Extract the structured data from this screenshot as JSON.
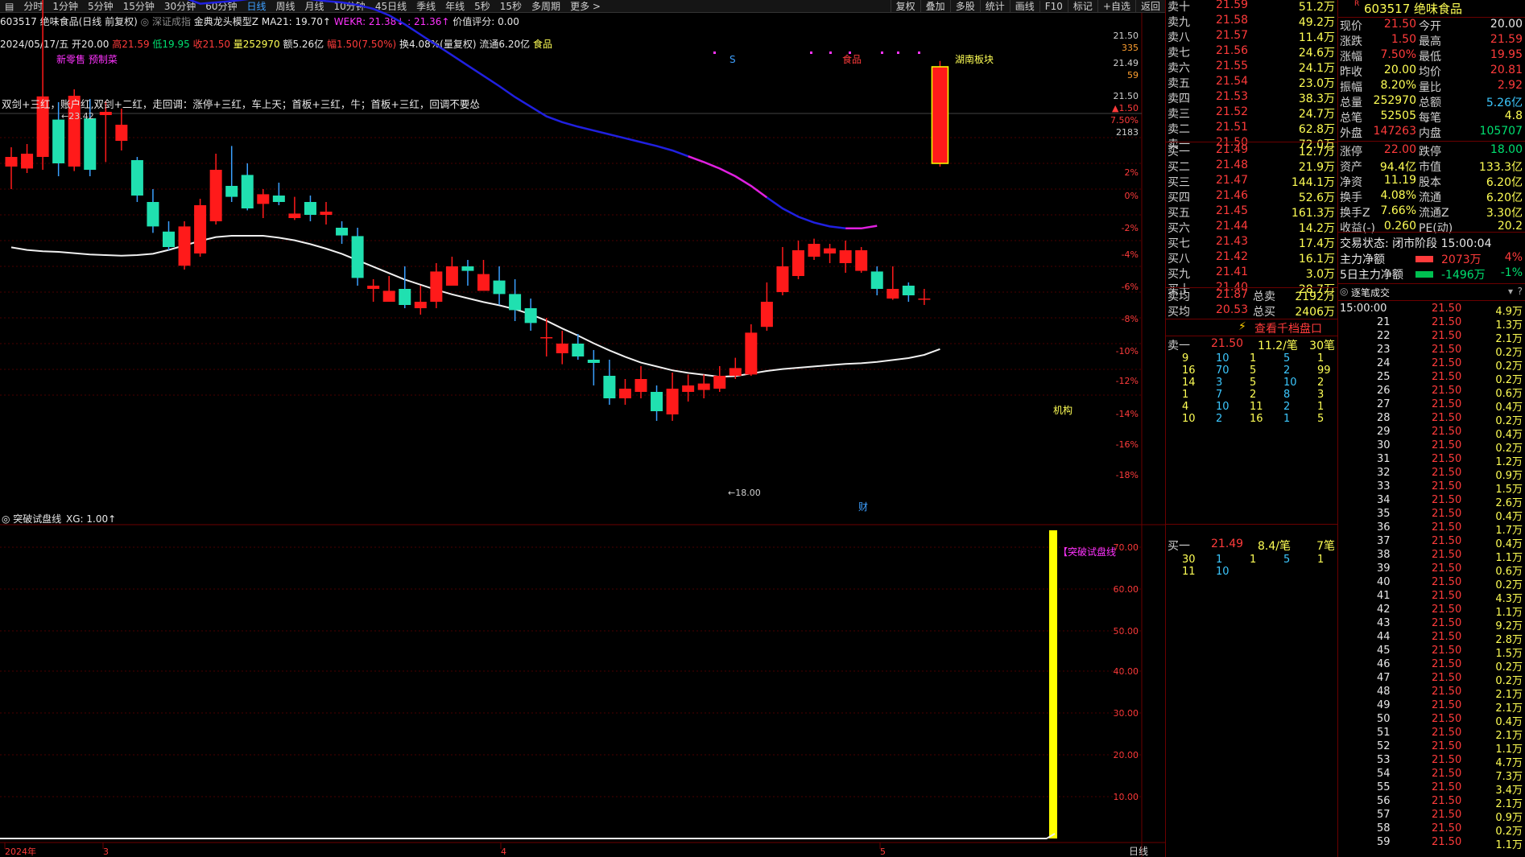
{
  "toolbar": {
    "tabs": [
      "分时",
      "1分钟",
      "5分钟",
      "15分钟",
      "30分钟",
      "60分钟",
      "日线",
      "周线",
      "月线",
      "10分钟",
      "45日线",
      "季线",
      "年线",
      "5秒",
      "15秒",
      "多周期",
      "更多 >"
    ],
    "active_index": 6,
    "right_items": [
      "复权",
      "叠加",
      "多股",
      "统计",
      "画线",
      "F10",
      "标记",
      "+自选",
      "返回"
    ]
  },
  "header": {
    "title": "603517 绝味食品(日线 前复权)",
    "indicator_label": "深证成指",
    "model_label": "金典龙头模型Z",
    "ma_text": "MA21: 19.70↑",
    "wekr_text": "WEKR: 21.38↓",
    "wekr2_text": ": 21.36↑",
    "score_text": "价值评分: 0.00"
  },
  "ohlc": {
    "date": "2024/05/17/五",
    "open": "开20.00",
    "high": "高21.59",
    "low": "低19.95",
    "close": "收21.50",
    "volume": "量252970",
    "amount": "额5.26亿",
    "range": "幅1.50(7.50%)",
    "turnover": "换4.08%(量复权)",
    "float": "流通6.20亿",
    "sector": "食品"
  },
  "annotations": {
    "top_left": "新零售 预制菜",
    "note": "双剑+三红，账户红,双剑+二红，走回调：涨停+三红，车上天；首板+三红，牛；首板+三红，回调不要怂",
    "s_label": "S",
    "food_label": "食品",
    "hunan_label": "湖南板块",
    "jigou_label": "机构",
    "cai_label": "财",
    "high_mark": "←23.42",
    "low_mark": "←18.00"
  },
  "price_axis": {
    "labels": [
      "21.50",
      "335",
      "21.49",
      "59",
      "21.50",
      "▲1.50",
      "7.50%",
      "2183",
      "2%",
      "0%",
      "-2%",
      "-4%",
      "-6%",
      "-8%",
      "-10%",
      "-12%",
      "-14%",
      "-16%",
      "-18%"
    ]
  },
  "indicator": {
    "title": "突破试盘线",
    "xg": "XG: 1.00↑",
    "signal_label": "【突破试盘线",
    "axis": [
      "70.00",
      "60.00",
      "50.00",
      "40.00",
      "30.00",
      "20.00",
      "10.00"
    ]
  },
  "date_axis": [
    "2024年",
    "3",
    "4",
    "5"
  ],
  "period_label": "日线",
  "chart_data": {
    "type": "candlestick",
    "candles": [
      {
        "o": 19.95,
        "c": 20.1,
        "h": 20.25,
        "l": 19.6
      },
      {
        "o": 19.92,
        "c": 20.15,
        "h": 20.3,
        "l": 19.85
      },
      {
        "o": 20.1,
        "c": 21.04,
        "h": 23.42,
        "l": 19.9
      },
      {
        "o": 20.68,
        "c": 20.0,
        "h": 20.95,
        "l": 19.8
      },
      {
        "o": 19.95,
        "c": 21.05,
        "h": 21.15,
        "l": 19.88
      },
      {
        "o": 20.7,
        "c": 19.9,
        "h": 21.0,
        "l": 19.8
      },
      {
        "o": 20.75,
        "c": 20.8,
        "h": 20.97,
        "l": 20.02
      },
      {
        "o": 20.35,
        "c": 20.6,
        "h": 20.85,
        "l": 20.2
      },
      {
        "o": 20.05,
        "c": 19.5,
        "h": 20.1,
        "l": 19.4
      },
      {
        "o": 19.4,
        "c": 19.02,
        "h": 19.6,
        "l": 18.92
      },
      {
        "o": 18.94,
        "c": 18.7,
        "h": 19.1,
        "l": 18.65
      },
      {
        "o": 18.41,
        "c": 19.02,
        "h": 19.1,
        "l": 18.35
      },
      {
        "o": 18.6,
        "c": 19.35,
        "h": 19.45,
        "l": 18.55
      },
      {
        "o": 19.1,
        "c": 19.9,
        "h": 20.15,
        "l": 19.05
      },
      {
        "o": 19.65,
        "c": 19.48,
        "h": 20.27,
        "l": 19.4
      },
      {
        "o": 19.82,
        "c": 19.3,
        "h": 20.0,
        "l": 19.27
      },
      {
        "o": 19.37,
        "c": 19.52,
        "h": 19.6,
        "l": 19.15
      },
      {
        "o": 19.5,
        "c": 19.4,
        "h": 19.7,
        "l": 19.35
      },
      {
        "o": 19.15,
        "c": 19.22,
        "h": 19.48,
        "l": 19.12
      },
      {
        "o": 19.4,
        "c": 19.2,
        "h": 19.5,
        "l": 19.1
      },
      {
        "o": 19.2,
        "c": 19.25,
        "h": 19.4,
        "l": 19.05
      },
      {
        "o": 19.0,
        "c": 18.88,
        "h": 19.1,
        "l": 18.75
      },
      {
        "o": 18.87,
        "c": 18.22,
        "h": 19.0,
        "l": 18.1
      },
      {
        "o": 18.05,
        "c": 18.1,
        "h": 18.2,
        "l": 17.85
      },
      {
        "o": 17.85,
        "c": 18.02,
        "h": 18.25,
        "l": 17.88
      },
      {
        "o": 18.05,
        "c": 17.8,
        "h": 18.4,
        "l": 17.75
      },
      {
        "o": 17.75,
        "c": 17.85,
        "h": 18.1,
        "l": 17.65
      },
      {
        "o": 17.85,
        "c": 18.32,
        "h": 18.45,
        "l": 17.75
      },
      {
        "o": 18.1,
        "c": 18.4,
        "h": 18.55,
        "l": 18.1
      },
      {
        "o": 18.4,
        "c": 18.33,
        "h": 18.5,
        "l": 18.1
      },
      {
        "o": 18.02,
        "c": 18.28,
        "h": 18.5,
        "l": 18.22
      },
      {
        "o": 18.18,
        "c": 17.97,
        "h": 18.4,
        "l": 17.8
      },
      {
        "o": 17.97,
        "c": 17.72,
        "h": 18.2,
        "l": 17.55
      },
      {
        "o": 17.75,
        "c": 17.52,
        "h": 17.9,
        "l": 17.4
      },
      {
        "o": 17.3,
        "c": 17.3,
        "h": 17.6,
        "l": 17.0
      },
      {
        "o": 17.05,
        "c": 17.2,
        "h": 17.4,
        "l": 16.88
      },
      {
        "o": 17.2,
        "c": 17.0,
        "h": 17.35,
        "l": 16.95
      },
      {
        "o": 16.95,
        "c": 16.9,
        "h": 17.1,
        "l": 16.55
      },
      {
        "o": 16.7,
        "c": 16.35,
        "h": 16.95,
        "l": 16.25
      },
      {
        "o": 16.35,
        "c": 16.5,
        "h": 16.65,
        "l": 16.25
      },
      {
        "o": 16.45,
        "c": 16.65,
        "h": 16.85,
        "l": 16.35
      },
      {
        "o": 16.45,
        "c": 16.15,
        "h": 16.55,
        "l": 16.0
      },
      {
        "o": 16.1,
        "c": 16.5,
        "h": 16.75,
        "l": 16.0
      },
      {
        "o": 16.45,
        "c": 16.55,
        "h": 16.72,
        "l": 16.3
      },
      {
        "o": 16.48,
        "c": 16.58,
        "h": 16.72,
        "l": 16.35
      },
      {
        "o": 16.5,
        "c": 16.7,
        "h": 16.85,
        "l": 16.45
      },
      {
        "o": 16.7,
        "c": 16.82,
        "h": 16.98,
        "l": 16.65
      },
      {
        "o": 16.72,
        "c": 17.37,
        "h": 17.5,
        "l": 16.7
      },
      {
        "o": 17.46,
        "c": 17.85,
        "h": 18.15,
        "l": 17.4
      },
      {
        "o": 18.0,
        "c": 18.4,
        "h": 18.7,
        "l": 17.95
      },
      {
        "o": 18.25,
        "c": 18.65,
        "h": 18.8,
        "l": 18.2
      },
      {
        "o": 18.55,
        "c": 18.75,
        "h": 18.83,
        "l": 18.5
      },
      {
        "o": 18.6,
        "c": 18.68,
        "h": 18.75,
        "l": 18.45
      },
      {
        "o": 18.45,
        "c": 18.65,
        "h": 18.8,
        "l": 18.3
      },
      {
        "o": 18.33,
        "c": 18.65,
        "h": 18.7,
        "l": 18.3
      },
      {
        "o": 18.32,
        "c": 18.05,
        "h": 18.4,
        "l": 17.95
      },
      {
        "o": 17.9,
        "c": 18.05,
        "h": 18.4,
        "l": 17.88
      },
      {
        "o": 18.1,
        "c": 17.95,
        "h": 18.15,
        "l": 17.85
      },
      {
        "o": 17.9,
        "c": 17.9,
        "h": 18.05,
        "l": 17.8
      },
      {
        "o": 20.0,
        "c": 21.5,
        "h": 21.59,
        "l": 19.95
      }
    ],
    "ma_white": [
      19.42,
      19.38,
      19.36,
      19.35,
      19.33,
      19.31,
      19.3,
      19.29,
      19.3,
      19.32,
      19.38,
      19.45,
      19.52,
      19.58,
      19.6,
      19.6,
      19.6,
      19.57,
      19.53,
      19.47,
      19.4,
      19.32,
      19.22,
      19.12,
      19.02,
      18.92,
      18.84,
      18.76,
      18.69,
      18.63,
      18.57,
      18.52,
      18.46,
      18.38,
      18.28,
      18.16,
      18.05,
      17.93,
      17.82,
      17.72,
      17.63,
      17.57,
      17.51,
      17.47,
      17.44,
      17.41,
      17.42,
      17.46,
      17.5,
      17.53,
      17.55,
      17.57,
      17.59,
      17.61,
      17.62,
      17.64,
      17.67,
      17.7,
      17.75,
      17.84
    ],
    "ma_blue": [
      23.07,
      23.07,
      22.98,
      22.87,
      22.75,
      22.65,
      22.5,
      22.32,
      22.12,
      21.92,
      21.74,
      21.57,
      21.48,
      21.5,
      21.52,
      21.55,
      21.58,
      21.6,
      21.58,
      21.55,
      21.52,
      21.5,
      21.46,
      21.4,
      21.3,
      21.16,
      21.0,
      20.84,
      20.68,
      20.52,
      20.36,
      20.2,
      20.03,
      19.88,
      19.73,
      19.64,
      19.57,
      19.51,
      19.45,
      19.39,
      19.33,
      19.27,
      19.2,
      19.11,
      19.02,
      18.92,
      18.8,
      18.65,
      18.47,
      18.3,
      18.17,
      18.08,
      18.02,
      17.99,
      17.99,
      18.03,
      18.12,
      18.28,
      18.49,
      18.71,
      18.92,
      19.13,
      19.34,
      19.55,
      19.71,
      19.84,
      19.92,
      19.9,
      19.75,
      19.4
    ],
    "signal_value": 75.0
  },
  "orderbook": {
    "asks": [
      {
        "label": "卖十",
        "price": "21.59",
        "vol": "51.2万"
      },
      {
        "label": "卖九",
        "price": "21.58",
        "vol": "49.2万"
      },
      {
        "label": "卖八",
        "price": "21.57",
        "vol": "11.4万"
      },
      {
        "label": "卖七",
        "price": "21.56",
        "vol": "24.6万"
      },
      {
        "label": "卖六",
        "price": "21.55",
        "vol": "24.1万"
      },
      {
        "label": "卖五",
        "price": "21.54",
        "vol": "23.0万"
      },
      {
        "label": "卖四",
        "price": "21.53",
        "vol": "38.3万"
      },
      {
        "label": "卖三",
        "price": "21.52",
        "vol": "24.7万"
      },
      {
        "label": "卖二",
        "price": "21.51",
        "vol": "62.8万"
      },
      {
        "label": "卖一",
        "price": "21.50",
        "vol": "72.0万"
      }
    ],
    "bids": [
      {
        "label": "买一",
        "price": "21.49",
        "vol": "12.7万"
      },
      {
        "label": "买二",
        "price": "21.48",
        "vol": "21.9万"
      },
      {
        "label": "买三",
        "price": "21.47",
        "vol": "144.1万"
      },
      {
        "label": "买四",
        "price": "21.46",
        "vol": "52.6万"
      },
      {
        "label": "买五",
        "price": "21.45",
        "vol": "161.3万"
      },
      {
        "label": "买六",
        "price": "21.44",
        "vol": "14.2万"
      },
      {
        "label": "买七",
        "price": "21.43",
        "vol": "17.4万"
      },
      {
        "label": "买八",
        "price": "21.42",
        "vol": "16.1万"
      },
      {
        "label": "买九",
        "price": "21.41",
        "vol": "3.0万"
      },
      {
        "label": "买十",
        "price": "21.40",
        "vol": "28.7万"
      }
    ],
    "avg_sell": {
      "label": "卖均",
      "price": "21.87",
      "tlabel": "总卖",
      "vol": "2192万"
    },
    "avg_buy": {
      "label": "买均",
      "price": "20.53",
      "tlabel": "总买",
      "vol": "2406万"
    },
    "link_text": "查看千档盘口",
    "sell1_line": {
      "label": "卖一",
      "price": "21.50",
      "avg": "11.2/笔",
      "count": "30笔"
    },
    "sell1_queue": [
      [
        "9",
        "10",
        "1",
        "5",
        "1"
      ],
      [
        "16",
        "70",
        "5",
        "2",
        "99"
      ],
      [
        "14",
        "3",
        "5",
        "10",
        "2"
      ],
      [
        "1",
        "7",
        "2",
        "8",
        "3"
      ],
      [
        "4",
        "10",
        "11",
        "2",
        "1"
      ],
      [
        "10",
        "2",
        "16",
        "1",
        "5"
      ]
    ],
    "buy1_line": {
      "label": "买一",
      "price": "21.49",
      "avg": "8.4/笔",
      "count": "7笔"
    },
    "buy1_queue": [
      [
        "30",
        "1",
        "1",
        "5",
        "1"
      ],
      [
        "11",
        "10",
        "",
        "",
        ""
      ]
    ]
  },
  "quote": {
    "code_name": "603517 绝味食品",
    "rows": [
      {
        "l1": "现价",
        "v1": "21.50",
        "l2": "今开",
        "v2": "20.00"
      },
      {
        "l1": "涨跌",
        "v1": "1.50",
        "l2": "最高",
        "v2": "21.59"
      },
      {
        "l1": "涨幅",
        "v1": "7.50%",
        "l2": "最低",
        "v2": "19.95"
      },
      {
        "l1": "昨收",
        "v1": "20.00",
        "l2": "均价",
        "v2": "20.81"
      },
      {
        "l1": "振幅",
        "v1": "8.20%",
        "l2": "量比",
        "v2": "2.92"
      },
      {
        "l1": "总量",
        "v1": "252970",
        "l2": "总额",
        "v2": "5.26亿"
      },
      {
        "l1": "总笔",
        "v1": "52505",
        "l2": "每笔",
        "v2": "4.8"
      },
      {
        "l1": "外盘",
        "v1": "147263",
        "l2": "内盘",
        "v2": "105707"
      },
      {
        "l1": "涨停",
        "v1": "22.00",
        "l2": "跌停",
        "v2": "18.00"
      },
      {
        "l1": "资产",
        "v1": "94.4亿",
        "l2": "市值",
        "v2": "133.3亿"
      },
      {
        "l1": "净资",
        "v1": "11.19",
        "l2": "股本",
        "v2": "6.20亿"
      },
      {
        "l1": "换手",
        "v1": "4.08%",
        "l2": "流通",
        "v2": "6.20亿"
      },
      {
        "l1": "换手Z",
        "v1": "7.66%",
        "l2": "流通Z",
        "v2": "3.30亿"
      },
      {
        "l1": "收益(-)",
        "v1": "0.260",
        "l2": "PE(动)",
        "v2": "20.2"
      }
    ],
    "status_label": "交易状态: 闭市阶段 15:00:04",
    "main_net": {
      "label": "主力净额",
      "value": "2073万",
      "pct": "4%"
    },
    "main_net5": {
      "label": "5日主力净额",
      "value": "-1496万",
      "pct": "-1%"
    },
    "ticks_title": "逐笔成交",
    "ticks": [
      {
        "t": "15:00:00",
        "p": "21.50",
        "v": "4.9万"
      },
      {
        "t": "21",
        "p": "21.50",
        "v": "1.3万"
      },
      {
        "t": "22",
        "p": "21.50",
        "v": "2.1万"
      },
      {
        "t": "23",
        "p": "21.50",
        "v": "0.2万"
      },
      {
        "t": "24",
        "p": "21.50",
        "v": "0.2万"
      },
      {
        "t": "25",
        "p": "21.50",
        "v": "0.2万"
      },
      {
        "t": "26",
        "p": "21.50",
        "v": "0.6万"
      },
      {
        "t": "27",
        "p": "21.50",
        "v": "0.4万"
      },
      {
        "t": "28",
        "p": "21.50",
        "v": "0.2万"
      },
      {
        "t": "29",
        "p": "21.50",
        "v": "0.4万"
      },
      {
        "t": "30",
        "p": "21.50",
        "v": "0.2万"
      },
      {
        "t": "31",
        "p": "21.50",
        "v": "1.2万"
      },
      {
        "t": "32",
        "p": "21.50",
        "v": "0.9万"
      },
      {
        "t": "33",
        "p": "21.50",
        "v": "1.5万"
      },
      {
        "t": "34",
        "p": "21.50",
        "v": "2.6万"
      },
      {
        "t": "35",
        "p": "21.50",
        "v": "0.4万"
      },
      {
        "t": "36",
        "p": "21.50",
        "v": "1.7万"
      },
      {
        "t": "37",
        "p": "21.50",
        "v": "0.4万"
      },
      {
        "t": "38",
        "p": "21.50",
        "v": "1.1万"
      },
      {
        "t": "39",
        "p": "21.50",
        "v": "0.6万"
      },
      {
        "t": "40",
        "p": "21.50",
        "v": "0.2万"
      },
      {
        "t": "41",
        "p": "21.50",
        "v": "4.3万"
      },
      {
        "t": "42",
        "p": "21.50",
        "v": "1.1万"
      },
      {
        "t": "43",
        "p": "21.50",
        "v": "9.2万"
      },
      {
        "t": "44",
        "p": "21.50",
        "v": "2.8万"
      },
      {
        "t": "45",
        "p": "21.50",
        "v": "1.5万"
      },
      {
        "t": "46",
        "p": "21.50",
        "v": "0.2万"
      },
      {
        "t": "47",
        "p": "21.50",
        "v": "0.2万"
      },
      {
        "t": "48",
        "p": "21.50",
        "v": "2.1万"
      },
      {
        "t": "49",
        "p": "21.50",
        "v": "2.1万"
      },
      {
        "t": "50",
        "p": "21.50",
        "v": "0.4万"
      },
      {
        "t": "51",
        "p": "21.50",
        "v": "2.1万"
      },
      {
        "t": "52",
        "p": "21.50",
        "v": "1.1万"
      },
      {
        "t": "53",
        "p": "21.50",
        "v": "4.7万"
      },
      {
        "t": "54",
        "p": "21.50",
        "v": "7.3万"
      },
      {
        "t": "55",
        "p": "21.50",
        "v": "3.4万"
      },
      {
        "t": "56",
        "p": "21.50",
        "v": "2.1万"
      },
      {
        "t": "57",
        "p": "21.50",
        "v": "0.9万"
      },
      {
        "t": "58",
        "p": "21.50",
        "v": "0.2万"
      },
      {
        "t": "59",
        "p": "21.50",
        "v": "1.1万"
      }
    ]
  },
  "colors": {
    "up": "#ff1a1a",
    "down": "#20e0b0",
    "ma_blue": "#2020e0",
    "ma_white": "#f0f0f0",
    "signal": "#ffff00",
    "border": "#6b0000"
  }
}
